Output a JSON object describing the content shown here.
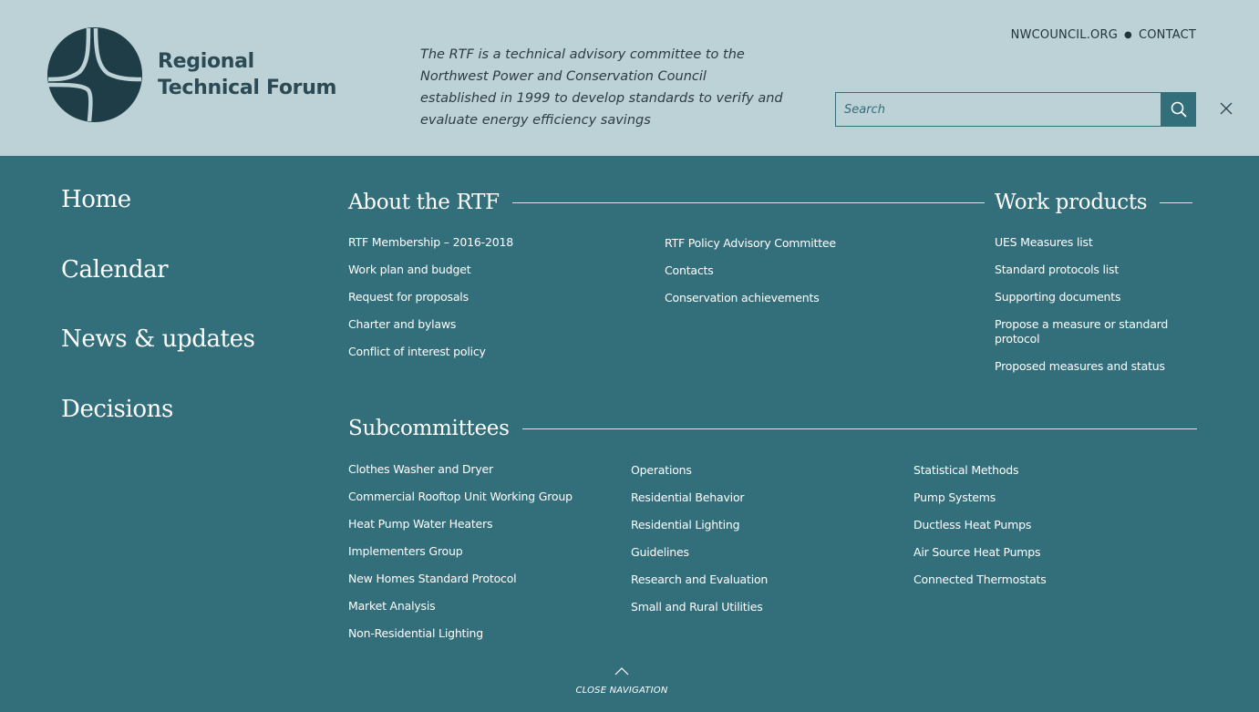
{
  "header": {
    "logo_line1": "Regional",
    "logo_line2": "Technical Forum",
    "tagline": "The RTF is a technical advisory committee to the Northwest Power and Conservation Council established in 1999 to develop standards to verify and evaluate energy efficiency savings",
    "top_links": [
      "NWCOUNCIL.ORG",
      "CONTACT"
    ],
    "search_placeholder": "Search",
    "search_icon": "search-icon",
    "close_icon": "close-icon"
  },
  "nav": {
    "primary": [
      "Home",
      "Calendar",
      "News & updates",
      "Decisions"
    ],
    "about": {
      "title": "About the RTF",
      "col1": [
        "RTF Membership – 2016-2018",
        "Work plan and budget",
        "Request for proposals",
        "Charter and bylaws",
        "Conflict of interest policy"
      ],
      "col2": [
        "RTF Policy Advisory Committee",
        "Contacts",
        "Conservation achievements"
      ]
    },
    "work_products": {
      "title": "Work products",
      "items": [
        "UES Measures list",
        "Standard protocols list",
        "Supporting documents",
        "Propose a measure or standard protocol",
        "Proposed measures and status"
      ]
    },
    "subcommittees": {
      "title": "Subcommittees",
      "col1": [
        "Clothes Washer and Dryer",
        "Commercial Rooftop Unit Working Group",
        "Heat Pump Water Heaters",
        "Implementers Group",
        "New Homes Standard Protocol",
        "Market Analysis",
        "Non-Residential Lighting"
      ],
      "col2": [
        "Operations",
        "Residential Behavior",
        "Residential Lighting",
        "Guidelines",
        "Research and Evaluation",
        "Small and Rural Utilities"
      ],
      "col3": [
        "Statistical Methods",
        "Pump Systems",
        "Ductless Heat Pumps",
        "Air Source Heat Pumps",
        "Connected Thermostats"
      ]
    },
    "close_label": "CLOSE NAVIGATION"
  },
  "colors": {
    "header_bg": "#bdd2d6",
    "nav_bg": "#336e7b",
    "logo_dark": "#1f3d46"
  }
}
